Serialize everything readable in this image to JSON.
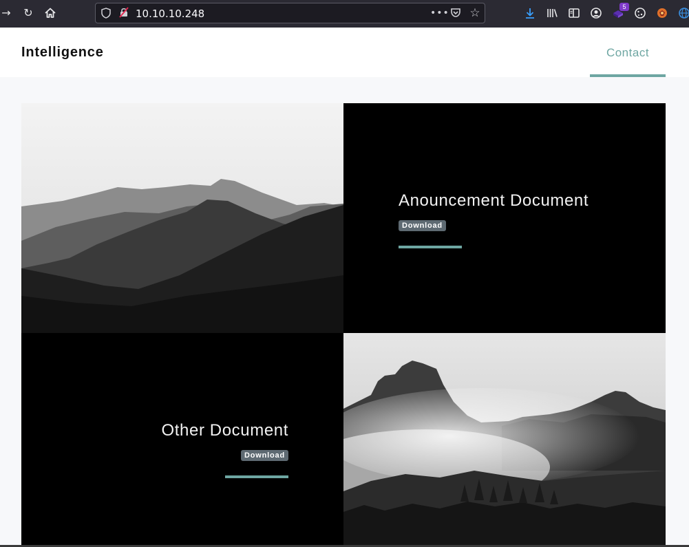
{
  "browser": {
    "url": "10.10.10.248",
    "extension_badge": "5",
    "icons": [
      "forward-icon",
      "reload-icon",
      "home-icon",
      "shield-icon",
      "insecure-lock-icon",
      "more-icon",
      "pocket-icon",
      "bookmark-star-icon",
      "download-icon",
      "library-icon",
      "sidebar-icon",
      "account-icon",
      "extension-icon",
      "cookie-icon",
      "fox-icon",
      "globe-icon"
    ]
  },
  "header": {
    "brand": "Intelligence",
    "nav": {
      "contact": "Contact"
    }
  },
  "documents": [
    {
      "title": "Anouncement Document",
      "download_label": "Download"
    },
    {
      "title": "Other Document",
      "download_label": "Download"
    }
  ],
  "images": [
    {
      "subject": "mountain ridges landscape, grayscale"
    },
    {
      "subject": "misty mountain peaks with forest, grayscale"
    }
  ],
  "colors": {
    "accent": "#6ea6a2",
    "dark": "#000000",
    "page_bg": "#f7f8fa"
  }
}
